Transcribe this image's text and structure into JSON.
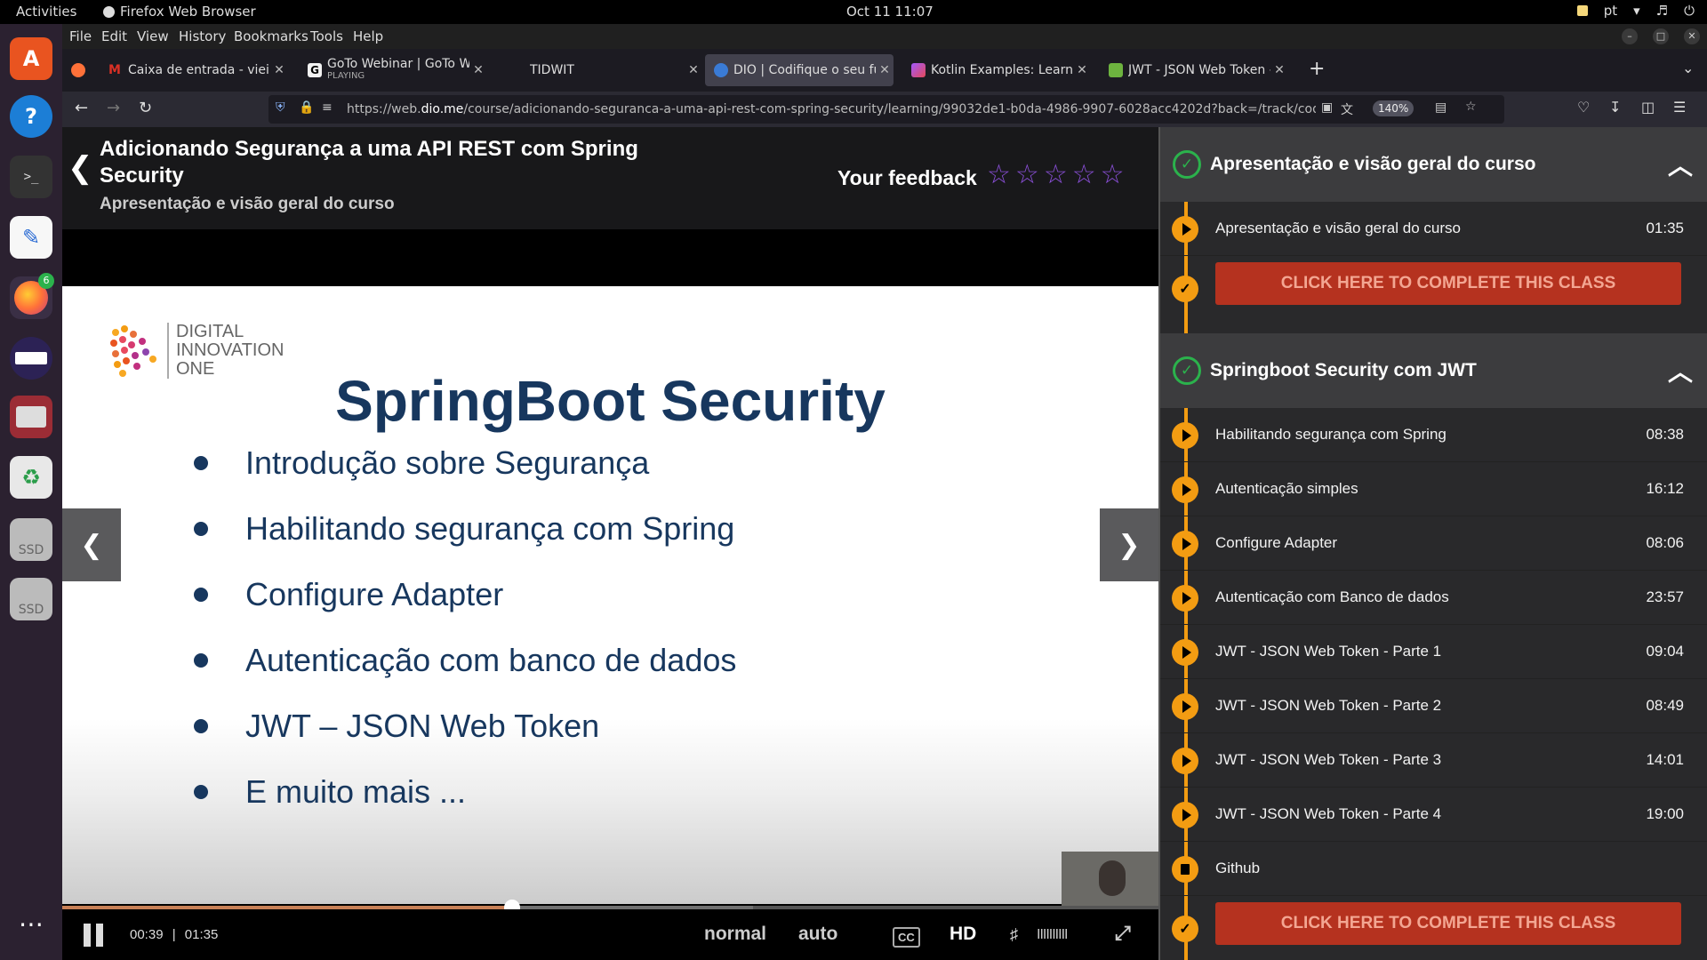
{
  "system": {
    "activities": "Activities",
    "app_name": "Firefox Web Browser",
    "clock": "Oct 11  11:07",
    "lang": "pt",
    "dock_badge": "6"
  },
  "menu": {
    "items": [
      "File",
      "Edit",
      "View",
      "History",
      "Bookmarks",
      "Tools",
      "Help"
    ]
  },
  "tabs": [
    {
      "label": "Caixa de entrada - vieira.f",
      "favicon_color": "#d93025",
      "favicon": "M",
      "subtitle": ""
    },
    {
      "label": "GoTo Webinar | GoTo We",
      "favicon_color": "#f2f2f2",
      "favicon": "G",
      "subtitle": "PLAYING"
    },
    {
      "label": "TIDWIT",
      "favicon_color": "",
      "favicon": "",
      "subtitle": ""
    },
    {
      "label": "DIO | Codifique o seu futu",
      "favicon_color": "#3a7bd5",
      "favicon": "",
      "subtitle": ""
    },
    {
      "label": "Kotlin Examples: Learn Ko",
      "favicon_color": "#a259ff",
      "favicon": "",
      "subtitle": ""
    },
    {
      "label": "JWT - JSON Web Token - S",
      "favicon_color": "#6db33f",
      "favicon": "",
      "subtitle": ""
    }
  ],
  "nav": {
    "url_prefix": "https://web.",
    "url_domain": "dio.me",
    "url_rest": "/course/adicionando-seguranca-a-uma-api-rest-com-spring-security/learning/99032de1-b0da-4986-9907-6028acc4202d?back=/track/code-",
    "zoom": "140%"
  },
  "course": {
    "title": "Adicionando Segurança a uma API REST com Spring Security",
    "subtitle": "Apresentação e visão geral do curso",
    "feedback_label": "Your feedback",
    "rating_max": 5,
    "rating": 0
  },
  "slide": {
    "logo_lines": [
      "DIGITAL",
      "INNOVATION",
      "ONE"
    ],
    "heading": "SpringBoot Security",
    "bullets": [
      "Introdução sobre Segurança",
      "Habilitando segurança com Spring",
      "Configure Adapter",
      "Autenticação com banco de dados",
      "JWT – JSON Web Token",
      "E muito mais ..."
    ]
  },
  "player": {
    "current_time": "00:39",
    "separator": "|",
    "duration": "01:35",
    "progress_fraction": 0.41,
    "buffered_fraction": 0.63,
    "speed_label": "normal",
    "quality_auto_label": "auto",
    "cc_label": "CC",
    "hd_label": "HD",
    "volume_label": "IIIIIIIIII"
  },
  "sidebar": {
    "complete_label": "CLICK HERE TO COMPLETE THIS CLASS",
    "section1": {
      "title": "Apresentação e visão geral do curso",
      "lessons": [
        {
          "label": "Apresentação e visão geral do curso",
          "duration": "01:35"
        }
      ]
    },
    "section2": {
      "title": "Springboot Security com JWT",
      "lessons": [
        {
          "label": "Habilitando segurança com Spring",
          "duration": "08:38"
        },
        {
          "label": "Autenticação simples",
          "duration": "16:12"
        },
        {
          "label": "Configure Adapter",
          "duration": "08:06"
        },
        {
          "label": "Autenticação com Banco de dados",
          "duration": "23:57"
        },
        {
          "label": "JWT - JSON Web Token - Parte 1",
          "duration": "09:04"
        },
        {
          "label": "JWT - JSON Web Token - Parte 2",
          "duration": "08:49"
        },
        {
          "label": "JWT - JSON Web Token - Parte 3",
          "duration": "14:01"
        },
        {
          "label": "JWT - JSON Web Token - Parte 4",
          "duration": "19:00"
        },
        {
          "label": "Github",
          "duration": ""
        }
      ]
    }
  },
  "colors": {
    "accent_orange": "#f39c12",
    "complete_button": "#b5321f",
    "star_purple": "#8a4fd8",
    "check_green": "#2bb24c",
    "slide_navy": "#17375e"
  }
}
